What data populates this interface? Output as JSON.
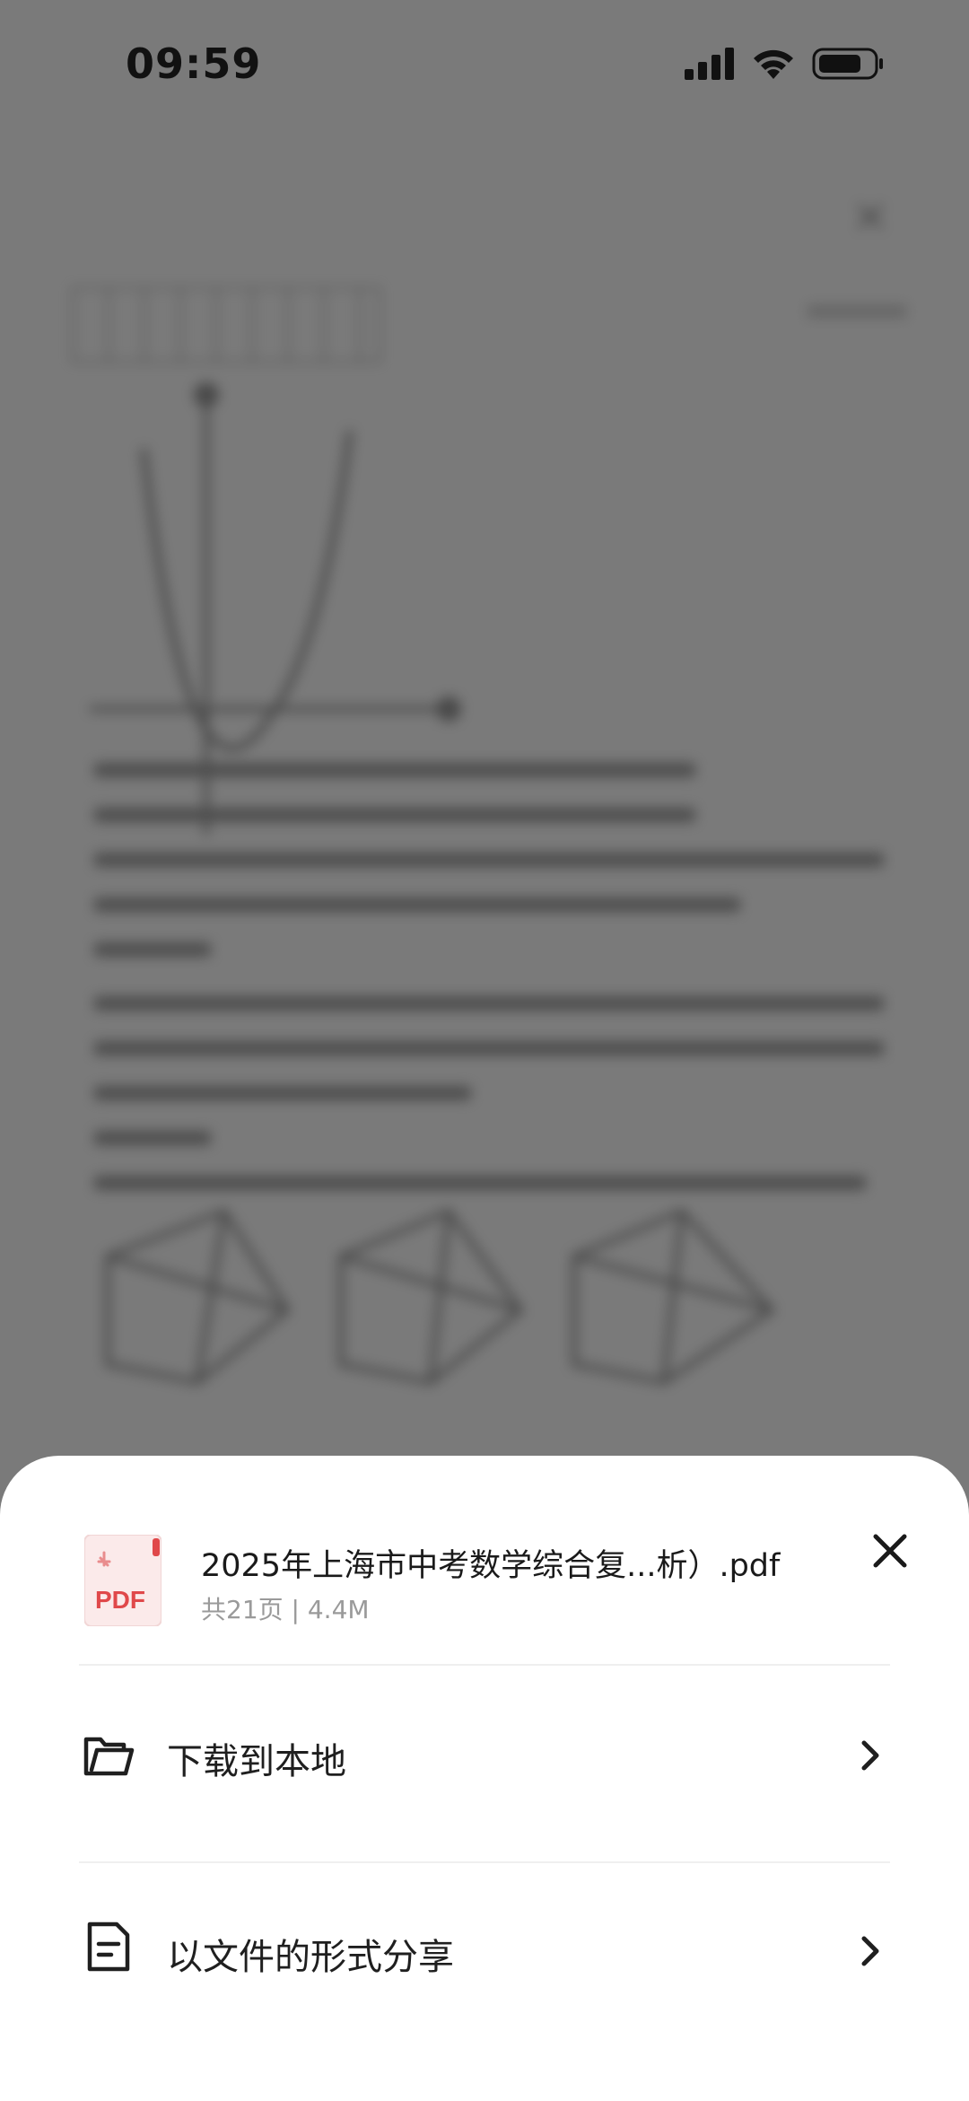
{
  "status_bar": {
    "time": "09:59",
    "icons": [
      "signal-icon",
      "wifi-icon",
      "battery-icon"
    ]
  },
  "background_document": {
    "title": "",
    "note": ""
  },
  "sheet": {
    "file": {
      "icon": "pdf-file-icon",
      "icon_label": "PDF",
      "name": "2025年上海市中考数学综合复...析）.pdf",
      "meta": "共21页 | 4.4M"
    },
    "actions": [
      {
        "icon": "folder-icon",
        "label": "下载到本地"
      },
      {
        "icon": "document-icon",
        "label": "以文件的形式分享"
      }
    ]
  },
  "colors": {
    "overlay": "#7a7a7a",
    "sheet_bg": "#ffffff",
    "pdf_red": "#e0484a",
    "text_primary": "#1f1f1f",
    "text_secondary": "#9a9a9a"
  }
}
